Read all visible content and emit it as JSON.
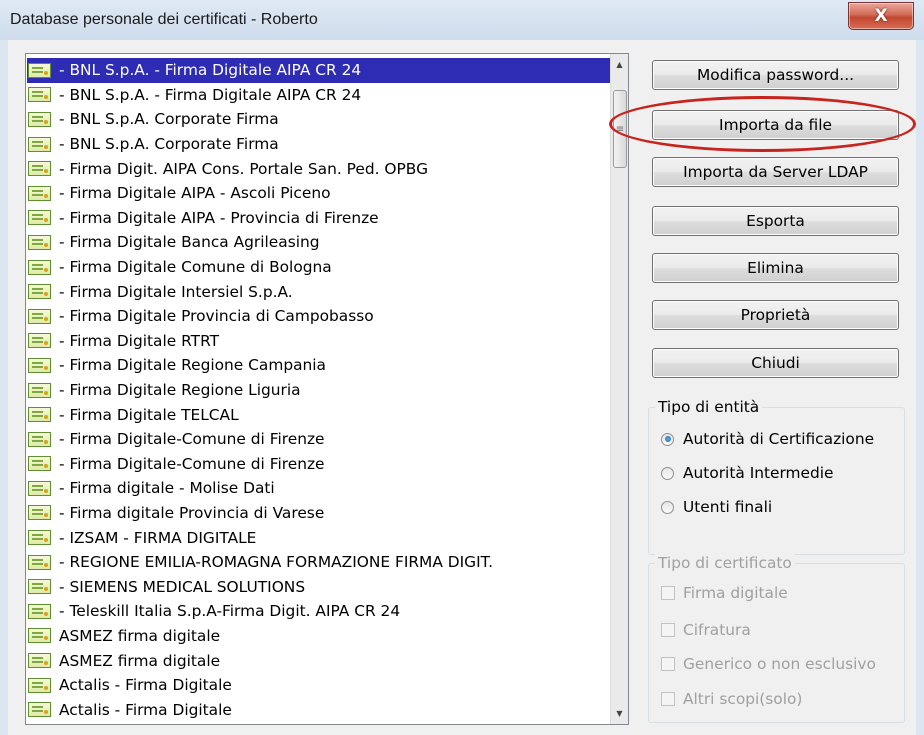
{
  "window": {
    "title": "Database personale dei certificati - Roberto",
    "close_label": "X"
  },
  "certificates": [
    "- BNL S.p.A. - Firma Digitale AIPA CR 24",
    "- BNL S.p.A. - Firma Digitale AIPA CR 24",
    "- BNL S.p.A. Corporate Firma",
    "- BNL S.p.A. Corporate Firma",
    "- Firma Digit. AIPA Cons. Portale San. Ped. OPBG",
    "- Firma Digitale AIPA - Ascoli Piceno",
    "- Firma Digitale AIPA - Provincia di Firenze",
    "- Firma Digitale Banca Agrileasing",
    "- Firma Digitale Comune di Bologna",
    "- Firma Digitale Intersiel S.p.A.",
    "- Firma Digitale Provincia di Campobasso",
    "- Firma Digitale RTRT",
    "- Firma Digitale Regione Campania",
    "- Firma Digitale Regione Liguria",
    "- Firma Digitale TELCAL",
    "- Firma Digitale-Comune di Firenze",
    "- Firma Digitale-Comune di Firenze",
    "- Firma digitale - Molise Dati",
    "- Firma digitale Provincia di Varese",
    "- IZSAM - FIRMA DIGITALE",
    "- REGIONE EMILIA-ROMAGNA FORMAZIONE FIRMA DIGIT.",
    "- SIEMENS MEDICAL SOLUTIONS",
    "- Teleskill Italia S.p.A-Firma Digit. AIPA CR 24",
    "ASMEZ firma digitale",
    "ASMEZ firma digitale",
    "Actalis - Firma Digitale",
    "Actalis - Firma Digitale"
  ],
  "selected_index": 0,
  "scrollbar": {
    "up_icon": "▲",
    "down_icon": "▼",
    "grip": "≡"
  },
  "buttons": {
    "modify_password": "Modifica password...",
    "import_file": "Importa da file",
    "import_ldap": "Importa da Server LDAP",
    "export": "Esporta",
    "delete": "Elimina",
    "properties": "Proprietà",
    "close": "Chiudi"
  },
  "entity_type": {
    "legend": "Tipo di entità",
    "options": [
      "Autorità di Certificazione",
      "Autorità Intermedie",
      "Utenti finali"
    ],
    "selected": 0
  },
  "cert_type": {
    "legend": "Tipo di certificato",
    "options": [
      "Firma digitale",
      "Cifratura",
      "Generico o non esclusivo",
      "Altri scopi(solo)"
    ],
    "disabled": true
  },
  "colors": {
    "selection": "#2e2bb5",
    "highlight_ring": "#c8241e"
  }
}
